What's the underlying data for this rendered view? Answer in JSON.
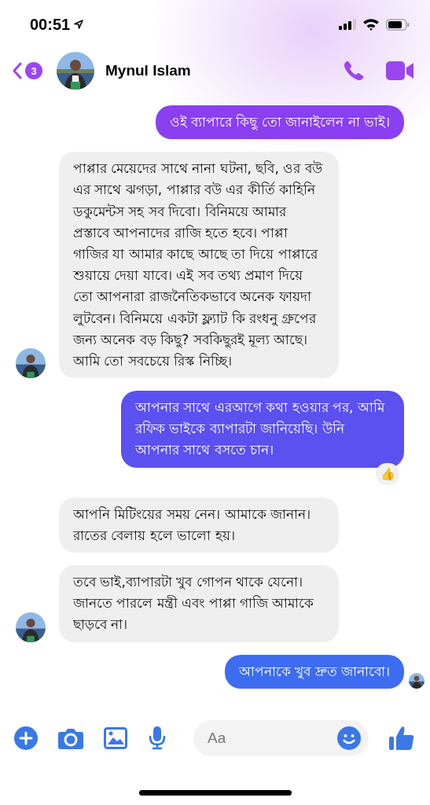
{
  "status_bar": {
    "time": "00:51"
  },
  "header": {
    "unread_count": "3",
    "contact_name": "Mynul Islam"
  },
  "messages": [
    {
      "kind": "outgoing",
      "text": "ওই ব্যাপারে কিছু তো জানাইলেন না ভাই।",
      "color": "#8a3ff0"
    },
    {
      "kind": "incoming",
      "text": "পাপ্পার মেয়েদের সাথে নানা ঘটনা, ছবি, ওর বউ এর সাথে ঝগড়া, পাপ্পার বউ এর কীর্তি কাহিনি ডকুমেন্টস সহ সব দিবো। বিনিময়ে আমার প্রস্তাবে আপনাদের রাজি হতে হবে। পাপ্পা গাজির যা আমার কাছে আছে তা দিয়ে পাপ্পারে শুয়ায়ে দেয়া যাবে। এই সব তথ্য প্রমাণ দিয়ে তো আপনারা রাজনৈতিকভাবে অনেক ফায়দা লুটবেন। বিনিময়ে একটা ফ্ল্যাট কি রংধনু গ্রুপের জন্য অনেক বড় কিছু? সবকিছুরই মূল্য আছে। আমি তো সবচেয়ে রিস্ক নিচ্ছি।",
      "avatar": true
    },
    {
      "kind": "outgoing",
      "text": "আপনার সাথে এরআগে কথা হওয়ার পর, আমি রফিক ভাইকে ব্যাপারটা জানিয়েছি। উনি আপনার সাথে বসতে চান।",
      "color": "#5b50f0",
      "reaction": "👍"
    },
    {
      "kind": "incoming",
      "text": "আপনি মিটিংয়ের সময় নেন। আমাকে জানান। রাতের বেলায় হলে ভালো হয়।",
      "avatar": false
    },
    {
      "kind": "incoming",
      "text": "তবে ভাই,ব্যাপারটা খুব গোপন থাকে যেনো। জানতে পারলে মন্ত্রী এবং পাপ্পা গাজি  আমাকে ছাড়বে না।",
      "avatar": true
    },
    {
      "kind": "outgoing",
      "text": "আপনাকে খুব দ্রুত জানাবো।",
      "color": "#3d6cf0",
      "seen": true
    }
  ],
  "composer": {
    "placeholder": "Aa"
  }
}
